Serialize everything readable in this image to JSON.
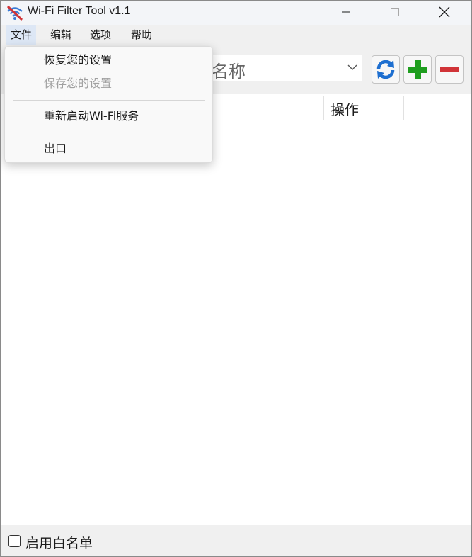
{
  "window": {
    "title": "Wi-Fi Filter Tool v1.1"
  },
  "menubar": {
    "items": [
      {
        "label": "文件"
      },
      {
        "label": "编辑"
      },
      {
        "label": "选项"
      },
      {
        "label": "帮助"
      }
    ]
  },
  "file_menu": {
    "items": [
      {
        "label": "恢复您的设置",
        "enabled": true
      },
      {
        "label": "保存您的设置",
        "enabled": false
      },
      {
        "label": "重新启动Wi-Fi服务",
        "enabled": true
      },
      {
        "label": "出口",
        "enabled": true
      }
    ]
  },
  "toolbar": {
    "network_combo_value": "名称",
    "refresh_icon": "refresh-icon",
    "add_icon": "plus-icon",
    "remove_icon": "minus-icon"
  },
  "list": {
    "columns": [
      {
        "label": "操作"
      }
    ]
  },
  "statusbar": {
    "whitelist_label": "启用白名单",
    "whitelist_checked": false
  },
  "colors": {
    "add_green": "#1f9e1f",
    "remove_red": "#d13438",
    "refresh_blue": "#1e6fd0"
  }
}
